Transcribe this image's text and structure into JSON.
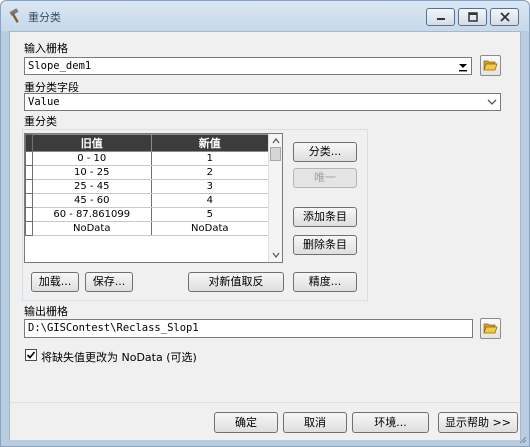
{
  "window": {
    "title": "重分类"
  },
  "input_raster": {
    "label": "输入栅格",
    "value": "Slope_dem1",
    "browse_icon": "folder-open-icon"
  },
  "reclass_field": {
    "label": "重分类字段",
    "value": "Value"
  },
  "reclass": {
    "label": "重分类",
    "columns": [
      "旧值",
      "新值"
    ],
    "rows": [
      {
        "old": "0 - 10",
        "new": "1"
      },
      {
        "old": "10 - 25",
        "new": "2"
      },
      {
        "old": "25 - 45",
        "new": "3"
      },
      {
        "old": "45 - 60",
        "new": "4"
      },
      {
        "old": "60 - 87.861099",
        "new": "5"
      },
      {
        "old": "NoData",
        "new": "NoData"
      }
    ],
    "buttons": {
      "classify": "分类...",
      "unique": "唯一",
      "add_entry": "添加条目",
      "delete_entry": "删除条目",
      "load": "加载...",
      "save": "保存...",
      "reverse": "对新值取反",
      "precision": "精度..."
    }
  },
  "output_raster": {
    "label": "输出栅格",
    "value": "D:\\GISContest\\Reclass_Slop1",
    "browse_icon": "folder-open-icon"
  },
  "nodata_option": {
    "label": "将缺失值更改为 NoData (可选)",
    "checked": true
  },
  "footer": {
    "ok": "确定",
    "cancel": "取消",
    "environments": "环境...",
    "show_help": "显示帮助 >>"
  }
}
